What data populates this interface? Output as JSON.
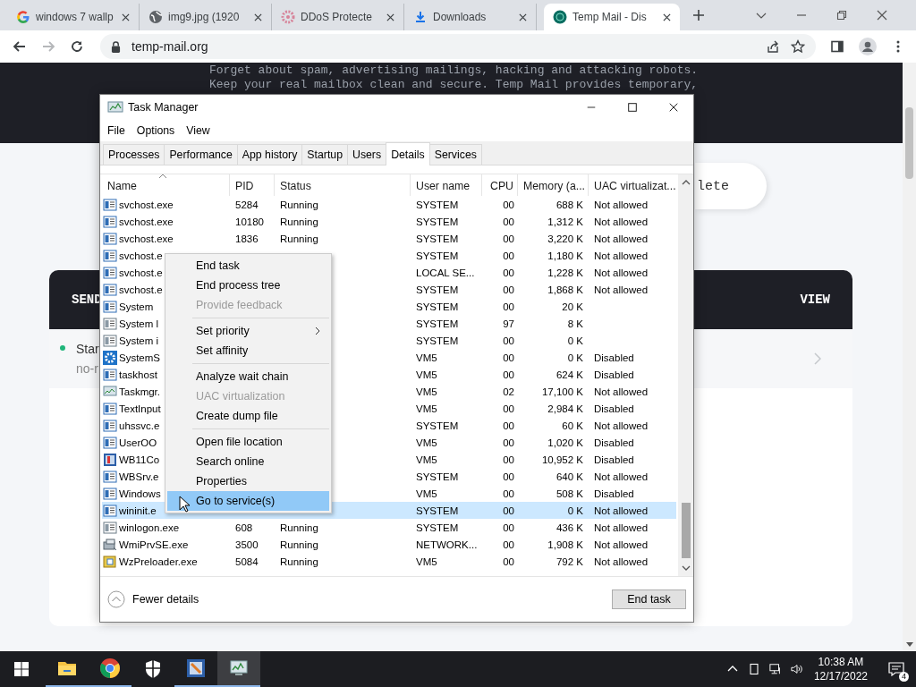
{
  "browser": {
    "tabs": [
      {
        "title": "windows 7 wallp",
        "kind": "google",
        "selected": false
      },
      {
        "title": "img9.jpg (1920",
        "kind": "globe",
        "selected": false
      },
      {
        "title": "DDoS Protecte",
        "kind": "shield",
        "selected": false
      },
      {
        "title": "Downloads",
        "kind": "download",
        "selected": false
      },
      {
        "title": "Temp Mail - Dis",
        "kind": "tempmail",
        "selected": true
      }
    ],
    "url": "temp-mail.org"
  },
  "page": {
    "intro_lines": [
      "Forget about spam, advertising mailings, hacking and attacking robots.",
      "Keep your real mailbox clean and secure. Temp Mail provides temporary,"
    ],
    "button_fragment": "lete",
    "inbox": {
      "column_left": "SEND",
      "column_right": "VIEW",
      "rows": [
        {
          "title": "Star",
          "subtitle": "no-r"
        }
      ]
    }
  },
  "task_manager": {
    "title": "Task Manager",
    "menu": [
      "File",
      "Options",
      "View"
    ],
    "tabs": [
      {
        "label": "Processes",
        "selected": false
      },
      {
        "label": "Performance",
        "selected": false
      },
      {
        "label": "App history",
        "selected": false
      },
      {
        "label": "Startup",
        "selected": false
      },
      {
        "label": "Users",
        "selected": false
      },
      {
        "label": "Details",
        "selected": true
      },
      {
        "label": "Services",
        "selected": false
      }
    ],
    "columns": [
      "Name",
      "PID",
      "Status",
      "User name",
      "CPU",
      "Memory (a...",
      "UAC virtualizat..."
    ],
    "rows": [
      {
        "kind": "window",
        "name": "svchost.exe",
        "pid": "5284",
        "status": "Running",
        "user": "SYSTEM",
        "cpu": "00",
        "memory": "688 K",
        "uac": "Not allowed",
        "selected": false
      },
      {
        "kind": "window",
        "name": "svchost.exe",
        "pid": "10180",
        "status": "Running",
        "user": "SYSTEM",
        "cpu": "00",
        "memory": "1,312 K",
        "uac": "Not allowed",
        "selected": false
      },
      {
        "kind": "window",
        "name": "svchost.exe",
        "pid": "1836",
        "status": "Running",
        "user": "SYSTEM",
        "cpu": "00",
        "memory": "3,220 K",
        "uac": "Not allowed",
        "selected": false
      },
      {
        "kind": "window",
        "name": "svchost.e",
        "user": "SYSTEM",
        "cpu": "00",
        "memory": "1,180 K",
        "uac": "Not allowed",
        "selected": false
      },
      {
        "kind": "window",
        "name": "svchost.e",
        "user": "LOCAL SE...",
        "cpu": "00",
        "memory": "1,228 K",
        "uac": "Not allowed",
        "selected": false
      },
      {
        "kind": "window",
        "name": "svchost.e",
        "user": "SYSTEM",
        "cpu": "00",
        "memory": "1,868 K",
        "uac": "Not allowed",
        "selected": false
      },
      {
        "kind": "window",
        "name": "System",
        "user": "SYSTEM",
        "cpu": "00",
        "memory": "20 K",
        "selected": false
      },
      {
        "kind": "grey",
        "name": "System l",
        "user": "SYSTEM",
        "cpu": "97",
        "memory": "8 K",
        "selected": false
      },
      {
        "kind": "grey",
        "name": "System i",
        "user": "SYSTEM",
        "cpu": "00",
        "memory": "0 K",
        "selected": false
      },
      {
        "kind": "gear",
        "name": "SystemS",
        "user": "VM5",
        "cpu": "00",
        "memory": "0 K",
        "uac": "Disabled",
        "selected": false
      },
      {
        "kind": "window",
        "name": "taskhost",
        "user": "VM5",
        "cpu": "00",
        "memory": "624 K",
        "uac": "Disabled",
        "selected": false
      },
      {
        "kind": "chart",
        "name": "Taskmgr.",
        "user": "VM5",
        "cpu": "02",
        "memory": "17,100 K",
        "uac": "Not allowed",
        "selected": false
      },
      {
        "kind": "window",
        "name": "TextInput",
        "user": "VM5",
        "cpu": "00",
        "memory": "2,984 K",
        "uac": "Disabled",
        "selected": false
      },
      {
        "kind": "window",
        "name": "uhssvc.e",
        "user": "SYSTEM",
        "cpu": "00",
        "memory": "60 K",
        "uac": "Not allowed",
        "selected": false
      },
      {
        "kind": "window",
        "name": "UserOO",
        "user": "VM5",
        "cpu": "00",
        "memory": "1,020 K",
        "uac": "Disabled",
        "selected": false
      },
      {
        "kind": "app",
        "name": "WB11Co",
        "user": "VM5",
        "cpu": "00",
        "memory": "10,952 K",
        "uac": "Disabled",
        "selected": false
      },
      {
        "kind": "window",
        "name": "WBSrv.e",
        "user": "SYSTEM",
        "cpu": "00",
        "memory": "640 K",
        "uac": "Not allowed",
        "selected": false
      },
      {
        "kind": "window",
        "name": "Windows",
        "user": "VM5",
        "cpu": "00",
        "memory": "508 K",
        "uac": "Disabled",
        "selected": false
      },
      {
        "kind": "window",
        "name": "wininit.e",
        "user": "SYSTEM",
        "cpu": "00",
        "memory": "0 K",
        "uac": "Not allowed",
        "selected": true
      },
      {
        "kind": "grey",
        "name": "winlogon.exe",
        "pid": "608",
        "status": "Running",
        "user": "SYSTEM",
        "cpu": "00",
        "memory": "436 K",
        "uac": "Not allowed",
        "selected": false
      },
      {
        "kind": "printer",
        "name": "WmiPrvSE.exe",
        "pid": "3500",
        "status": "Running",
        "user": "NETWORK...",
        "cpu": "00",
        "memory": "1,908 K",
        "uac": "Not allowed",
        "selected": false
      },
      {
        "kind": "package",
        "name": "WzPreloader.exe",
        "pid": "5084",
        "status": "Running",
        "user": "VM5",
        "cpu": "00",
        "memory": "792 K",
        "uac": "Not allowed",
        "selected": false
      }
    ],
    "fewer_details": "Fewer details",
    "end_task": "End task"
  },
  "context_menu": {
    "groups": [
      [
        {
          "label": "End task",
          "disabled": false,
          "submenu": false,
          "selected": false
        },
        {
          "label": "End process tree",
          "disabled": false,
          "submenu": false,
          "selected": false
        },
        {
          "label": "Provide feedback",
          "disabled": true,
          "submenu": false,
          "selected": false
        }
      ],
      [
        {
          "label": "Set priority",
          "disabled": false,
          "submenu": true,
          "selected": false
        },
        {
          "label": "Set affinity",
          "disabled": false,
          "submenu": false,
          "selected": false
        }
      ],
      [
        {
          "label": "Analyze wait chain",
          "disabled": false,
          "submenu": false,
          "selected": false
        },
        {
          "label": "UAC virtualization",
          "disabled": true,
          "submenu": false,
          "selected": false
        },
        {
          "label": "Create dump file",
          "disabled": false,
          "submenu": false,
          "selected": false
        }
      ],
      [
        {
          "label": "Open file location",
          "disabled": false,
          "submenu": false,
          "selected": false
        },
        {
          "label": "Search online",
          "disabled": false,
          "submenu": false,
          "selected": false
        },
        {
          "label": "Properties",
          "disabled": false,
          "submenu": false,
          "selected": false
        },
        {
          "label": "Go to service(s)",
          "disabled": false,
          "submenu": false,
          "selected": true
        }
      ]
    ]
  },
  "taskbar": {
    "apps": [
      {
        "kind": "folder",
        "running": true,
        "selected": false
      },
      {
        "kind": "chrome",
        "running": true,
        "selected": false
      },
      {
        "kind": "shield",
        "running": false,
        "selected": false
      },
      {
        "kind": "app",
        "running": true,
        "selected": false
      },
      {
        "kind": "monitor",
        "running": true,
        "selected": true
      }
    ],
    "time": "10:38 AM",
    "date": "12/17/2022",
    "notification_count": "4"
  }
}
